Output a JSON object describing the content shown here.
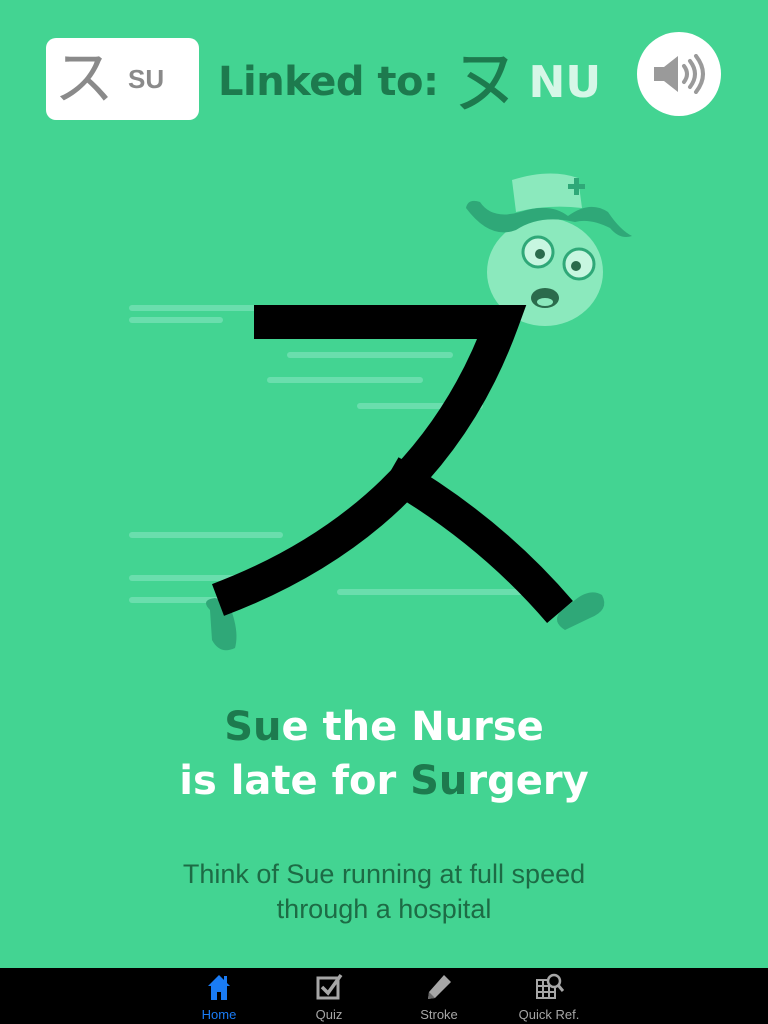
{
  "header": {
    "kana": "ス",
    "romaji": "SU",
    "linked_label": "Linked to:",
    "linked_kana": "ヌ",
    "linked_romaji": "NU",
    "sound_icon": "speaker-icon"
  },
  "illustration": {
    "character": "ス",
    "description_icon": "nurse-running-illustration"
  },
  "mnemonic": {
    "line1": [
      "Su",
      "e the Nurse"
    ],
    "line2": [
      "is late for ",
      "Su",
      "rgery"
    ]
  },
  "hint": {
    "line1": "Think of Sue running at full speed",
    "line2": "through a hospital"
  },
  "tabs": [
    {
      "label": "Home",
      "icon": "home-icon",
      "active": true
    },
    {
      "label": "Quiz",
      "icon": "checkbox-icon",
      "active": false
    },
    {
      "label": "Stroke",
      "icon": "pencil-icon",
      "active": false
    },
    {
      "label": "Quick Ref.",
      "icon": "grid-search-icon",
      "active": false
    }
  ],
  "colors": {
    "background": "#43d492",
    "highlight": "#1d7a4e",
    "tab_active": "#1a7cf5"
  }
}
